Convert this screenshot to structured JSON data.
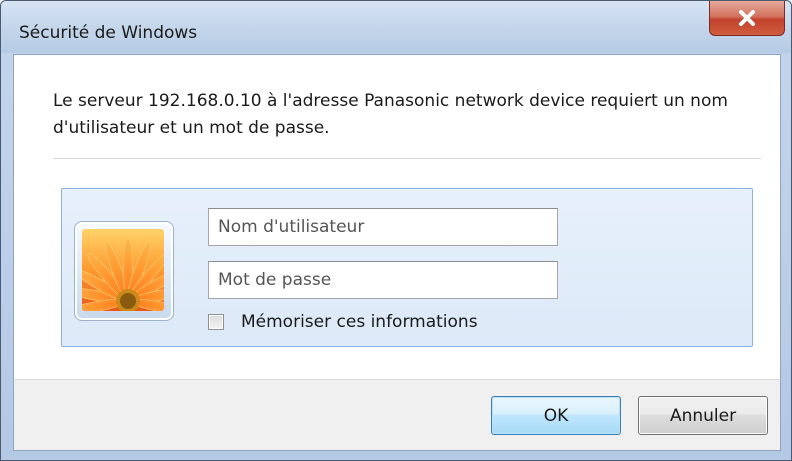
{
  "window": {
    "title": "Sécurité de Windows",
    "close_icon": "close-icon"
  },
  "dialog": {
    "message": "Le serveur 192.168.0.10 à l'adresse Panasonic network device requiert un nom d'utilisateur et un mot de passe.",
    "avatar_icon": "flower-user-picture-icon",
    "username": {
      "placeholder": "Nom d'utilisateur",
      "value": ""
    },
    "password": {
      "placeholder": "Mot de passe",
      "value": ""
    },
    "remember": {
      "label": "Mémoriser ces informations",
      "checked": false
    }
  },
  "buttons": {
    "ok_label": "OK",
    "cancel_label": "Annuler"
  },
  "colors": {
    "close_button": "#c2412c",
    "credential_panel": "#dce9f8",
    "ok_button_border": "#3c7fb1"
  }
}
